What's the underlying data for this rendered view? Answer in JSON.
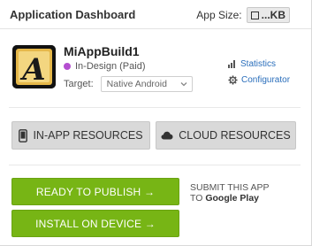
{
  "header": {
    "title": "Application Dashboard",
    "app_size_label": "App Size:",
    "app_size_value": "...KB"
  },
  "app": {
    "name": "MiAppBuild1",
    "status": "In-Design (Paid)",
    "status_color": "#b44fd0",
    "icon_letter": "A",
    "target_label": "Target:",
    "target_value": "Native Android"
  },
  "links": {
    "statistics": "Statistics",
    "configurator": "Configurator"
  },
  "resources": {
    "in_app": "IN-APP RESOURCES",
    "cloud": "CLOUD RESOURCES"
  },
  "actions": {
    "publish": "READY TO PUBLISH →",
    "install": "INSTALL ON DEVICE →",
    "submit_line1": "SUBMIT THIS APP",
    "submit_line2_prefix": "TO",
    "submit_line2_store": "Google Play"
  },
  "colors": {
    "accent_green": "#77b515",
    "link_blue": "#2a6ebb"
  }
}
